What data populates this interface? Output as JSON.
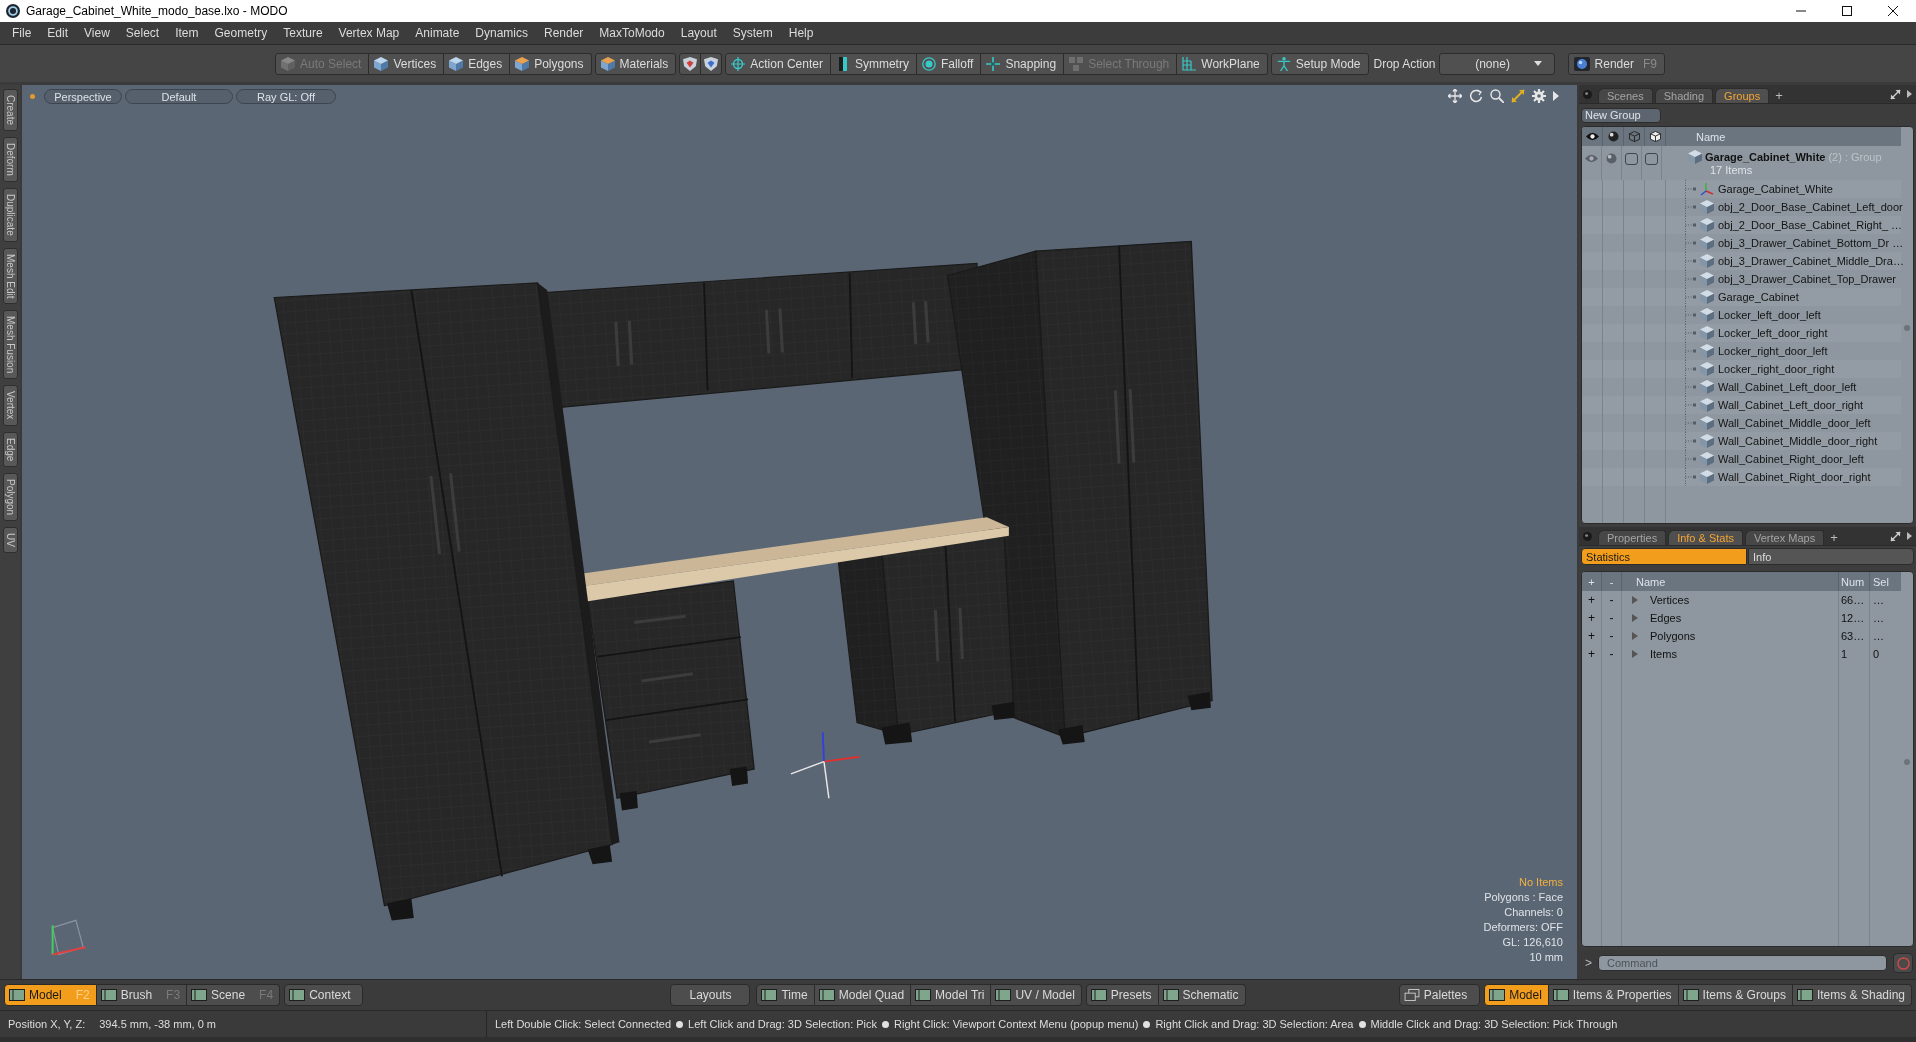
{
  "window": {
    "title": "Garage_Cabinet_White_modo_base.lxo - MODO"
  },
  "menu": [
    "File",
    "Edit",
    "View",
    "Select",
    "Item",
    "Geometry",
    "Texture",
    "Vertex Map",
    "Animate",
    "Dynamics",
    "Render",
    "MaxToModo",
    "Layout",
    "System",
    "Help"
  ],
  "toolbar": {
    "groups": [
      [
        {
          "kind": "button",
          "label": "Auto Select",
          "disabled": true
        },
        {
          "kind": "button",
          "label": "Vertices",
          "disabled": false
        },
        {
          "kind": "button",
          "label": "Edges",
          "disabled": false
        },
        {
          "kind": "button",
          "label": "Polygons",
          "disabled": false
        }
      ],
      [
        {
          "kind": "button",
          "label": "Materials",
          "disabled": false
        }
      ],
      [
        {
          "kind": "icon",
          "disabled": false
        },
        {
          "kind": "icon",
          "disabled": false
        }
      ],
      [
        {
          "kind": "button",
          "label": "Action Center",
          "disabled": false
        },
        {
          "kind": "button",
          "label": "Symmetry",
          "disabled": false
        },
        {
          "kind": "button",
          "label": "Falloff",
          "disabled": false
        },
        {
          "kind": "button",
          "label": "Snapping",
          "disabled": false
        },
        {
          "kind": "button",
          "label": "Select Through",
          "disabled": true
        },
        {
          "kind": "button",
          "label": "WorkPlane",
          "disabled": false
        }
      ],
      [
        {
          "kind": "button",
          "label": "Setup Mode",
          "disabled": false
        }
      ]
    ],
    "drop_action": {
      "label": "Drop Action",
      "value": "(none)"
    },
    "render": {
      "label": "Render",
      "shortcut": "F9"
    }
  },
  "side_tabs": [
    "Create",
    "Deform",
    "Duplicate",
    "Mesh Edit",
    "Mesh Fusion",
    "Vertex",
    "Edge",
    "Polygon",
    "UV"
  ],
  "viewport": {
    "buttons": [
      "Perspective",
      "Default",
      "Ray GL: Off"
    ],
    "info": [
      {
        "text": "No Items",
        "highlight": true
      },
      {
        "text": "Polygons : Face",
        "highlight": false
      },
      {
        "text": "Channels: 0",
        "highlight": false
      },
      {
        "text": "Deformers: OFF",
        "highlight": false
      },
      {
        "text": "GL: 126,610",
        "highlight": false
      },
      {
        "text": "10 mm",
        "highlight": false
      }
    ]
  },
  "groups_panel": {
    "tabs": [
      {
        "label": "Scenes",
        "selected": false
      },
      {
        "label": "Shading",
        "selected": false
      },
      {
        "label": "Groups",
        "selected": true
      }
    ],
    "add_tab": "+",
    "new_group": "New Group",
    "name_column": "Name",
    "group": {
      "name": "Garage_Cabinet_White",
      "count": "(2)",
      "type": ": Group",
      "subtitle": "17 Items",
      "children": [
        {
          "name": "Garage_Cabinet_White",
          "kind": "locator"
        },
        {
          "name": "obj_2_Door_Base_Cabinet_Left_door",
          "kind": "mesh"
        },
        {
          "name": "obj_2_Door_Base_Cabinet_Right_ …",
          "kind": "mesh"
        },
        {
          "name": "obj_3_Drawer_Cabinet_Bottom_Dr …",
          "kind": "mesh"
        },
        {
          "name": "obj_3_Drawer_Cabinet_Middle_Dra…",
          "kind": "mesh"
        },
        {
          "name": "obj_3_Drawer_Cabinet_Top_Drawer",
          "kind": "mesh"
        },
        {
          "name": "Garage_Cabinet",
          "kind": "mesh"
        },
        {
          "name": "Locker_left_door_left",
          "kind": "mesh"
        },
        {
          "name": "Locker_left_door_right",
          "kind": "mesh"
        },
        {
          "name": "Locker_right_door_left",
          "kind": "mesh"
        },
        {
          "name": "Locker_right_door_right",
          "kind": "mesh"
        },
        {
          "name": "Wall_Cabinet_Left_door_left",
          "kind": "mesh"
        },
        {
          "name": "Wall_Cabinet_Left_door_right",
          "kind": "mesh"
        },
        {
          "name": "Wall_Cabinet_Middle_door_left",
          "kind": "mesh"
        },
        {
          "name": "Wall_Cabinet_Middle_door_right",
          "kind": "mesh"
        },
        {
          "name": "Wall_Cabinet_Right_door_left",
          "kind": "mesh"
        },
        {
          "name": "Wall_Cabinet_Right_door_right",
          "kind": "mesh"
        }
      ]
    }
  },
  "stats_panel": {
    "tabs": [
      {
        "label": "Properties",
        "selected": false
      },
      {
        "label": "Info & Stats",
        "selected": true
      },
      {
        "label": "Vertex Maps",
        "selected": false
      }
    ],
    "add_tab": "+",
    "subtabs": [
      {
        "label": "Statistics",
        "selected": true
      },
      {
        "label": "Info",
        "selected": false
      }
    ],
    "columns": [
      "+",
      "-",
      "Name",
      "Num",
      "Sel"
    ],
    "rows": [
      {
        "add": "+",
        "remove": "-",
        "name": "Vertices",
        "num": "66…",
        "sel": "…"
      },
      {
        "add": "+",
        "remove": "-",
        "name": "Edges",
        "num": "12…",
        "sel": "…"
      },
      {
        "add": "+",
        "remove": "-",
        "name": "Polygons",
        "num": "63…",
        "sel": "…"
      },
      {
        "add": "+",
        "remove": "-",
        "name": "Items",
        "num": "1",
        "sel": "0"
      }
    ]
  },
  "command": {
    "prompt": ">",
    "placeholder": "Command"
  },
  "bottom_bar": {
    "modes": [
      {
        "label": "Model",
        "shortcut": "F2",
        "selected": true
      },
      {
        "label": "Brush",
        "shortcut": "F3",
        "selected": false
      },
      {
        "label": "Scene",
        "shortcut": "F4",
        "selected": false
      }
    ],
    "context": "Context",
    "layouts_button": "Layouts",
    "layout_groups": [
      [
        "Time",
        "Model Quad",
        "Model Tri",
        "UV / Model"
      ],
      [
        "Presets",
        "Schematic"
      ]
    ],
    "palettes": "Palettes",
    "layouts": [
      {
        "label": "Model",
        "selected": true
      },
      {
        "label": "Items & Properties",
        "selected": false
      },
      {
        "label": "Items & Groups",
        "selected": false
      },
      {
        "label": "Items & Shading",
        "selected": false
      }
    ]
  },
  "status_bar": {
    "position_label": "Position X, Y, Z:",
    "position_value": "394.5 mm, -38 mm, 0 m",
    "hints": [
      "Left Double Click: Select Connected",
      "Left Click and Drag: 3D Selection: Pick",
      "Right Click: Viewport Context Menu (popup menu)",
      "Right Click and Drag: 3D Selection: Area",
      "Middle Click and Drag: 3D Selection: Pick Through"
    ]
  }
}
